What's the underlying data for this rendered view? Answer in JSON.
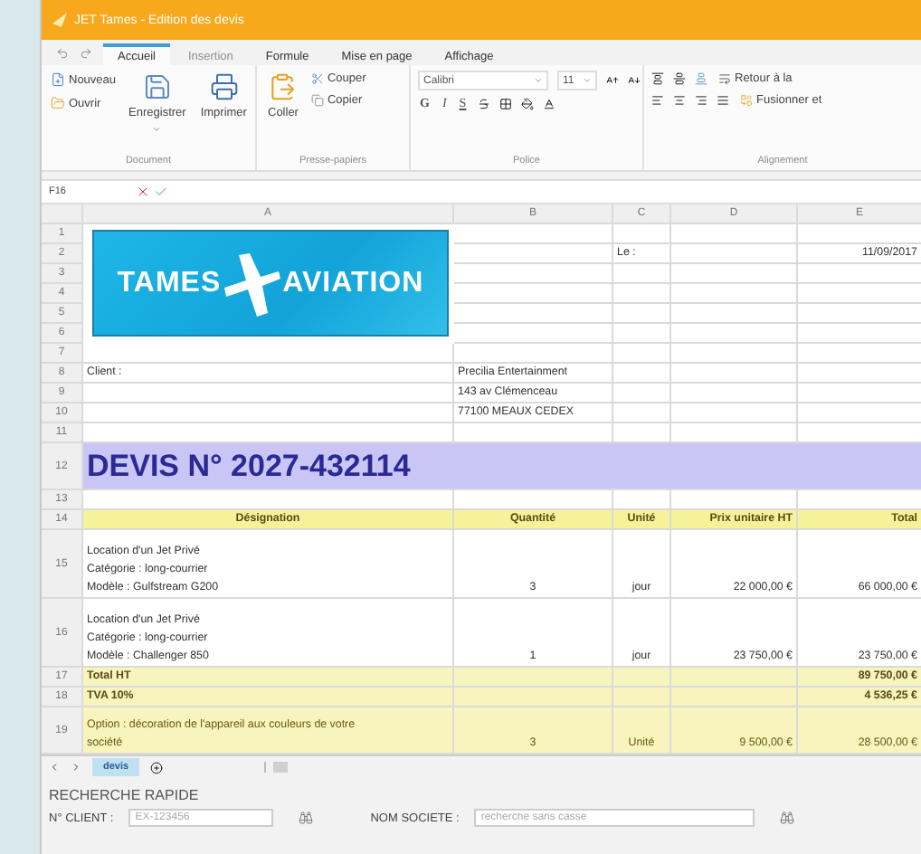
{
  "window": {
    "title": "JET Tames - Edition des devis"
  },
  "ribbon_tabs": [
    {
      "label": "Accueil",
      "selected": true,
      "disabled": false
    },
    {
      "label": "Insertion",
      "selected": false,
      "disabled": true
    },
    {
      "label": "Formule",
      "selected": false,
      "disabled": false
    },
    {
      "label": "Mise en page",
      "selected": false,
      "disabled": false
    },
    {
      "label": "Affichage",
      "selected": false,
      "disabled": false
    }
  ],
  "ribbon": {
    "new": "Nouveau",
    "open": "Ouvrir",
    "save": "Enregistrer",
    "print": "Imprimer",
    "paste": "Coller",
    "cut": "Couper",
    "copy": "Copier",
    "font": "Calibri",
    "font_size": "11",
    "bold": "G",
    "italic": "I",
    "underline": "S",
    "wrap": "Retour à la",
    "merge": "Fusionner et",
    "group_labels": [
      "Document",
      "Presse-papiers",
      "Police",
      "Alignement"
    ]
  },
  "formula_bar": {
    "cell": "F16"
  },
  "sheet": {
    "columns": [
      "A",
      "B",
      "C",
      "D",
      "E"
    ],
    "logo": {
      "left": "TAMES",
      "right": "AVIATION"
    },
    "rows": [
      {
        "num": "1",
        "kind": "plain"
      },
      {
        "num": "2",
        "kind": "plain",
        "c": "Le :",
        "e": "11/09/2017"
      },
      {
        "num": "3",
        "kind": "plain"
      },
      {
        "num": "4",
        "kind": "plain"
      },
      {
        "num": "5",
        "kind": "plain"
      },
      {
        "num": "6",
        "kind": "plain"
      },
      {
        "num": "7",
        "kind": "plain"
      },
      {
        "num": "8",
        "kind": "plain",
        "a": "Client :",
        "b": "Precilia Entertainment"
      },
      {
        "num": "9",
        "kind": "plain",
        "b": "143 av Clémenceau"
      },
      {
        "num": "10",
        "kind": "plain",
        "b": "77100 MEAUX CEDEX"
      },
      {
        "num": "11",
        "kind": "plain"
      },
      {
        "num": "12",
        "kind": "title",
        "a": "DEVIS N° 2027-432114"
      },
      {
        "num": "13",
        "kind": "plain"
      },
      {
        "num": "14",
        "kind": "header",
        "a": "Désignation",
        "b": "Quantité",
        "c": "Unité",
        "d": "Prix unitaire HT",
        "e": "Total"
      },
      {
        "num": "15",
        "kind": "item",
        "lines": [
          "Location d'un Jet Privé",
          "Catégorie : long-courrier",
          "Modèle : Gulfstream G200"
        ],
        "b": "3",
        "c": "jour",
        "d": "22 000,00 €",
        "e": "66 000,00 €"
      },
      {
        "num": "16",
        "kind": "item",
        "lines": [
          "Location d'un Jet Privé",
          "Catégorie : long-courrier",
          "Modèle : Challenger 850"
        ],
        "b": "1",
        "c": "jour",
        "d": "23 750,00 €",
        "e": "23 750,00 €"
      },
      {
        "num": "17",
        "kind": "total",
        "a": "Total HT",
        "e": "89 750,00 €"
      },
      {
        "num": "18",
        "kind": "total",
        "a": "TVA 10%",
        "e": "4 536,25 €"
      },
      {
        "num": "19",
        "kind": "option",
        "lines": [
          "Option : décoration de l'appareil aux couleurs de votre",
          "société"
        ],
        "b": "3",
        "c": "Unité",
        "d": "9 500,00 €",
        "e": "28 500,00 €"
      }
    ]
  },
  "sheet_tabs": [
    {
      "label": "devis",
      "selected": true
    }
  ],
  "search": {
    "title": "RECHERCHE RAPIDE",
    "client": {
      "label": "N° CLIENT :",
      "placeholder": "EX-123456"
    },
    "company": {
      "label": "NOM SOCIETE :",
      "placeholder": "recherche sans casse"
    }
  }
}
